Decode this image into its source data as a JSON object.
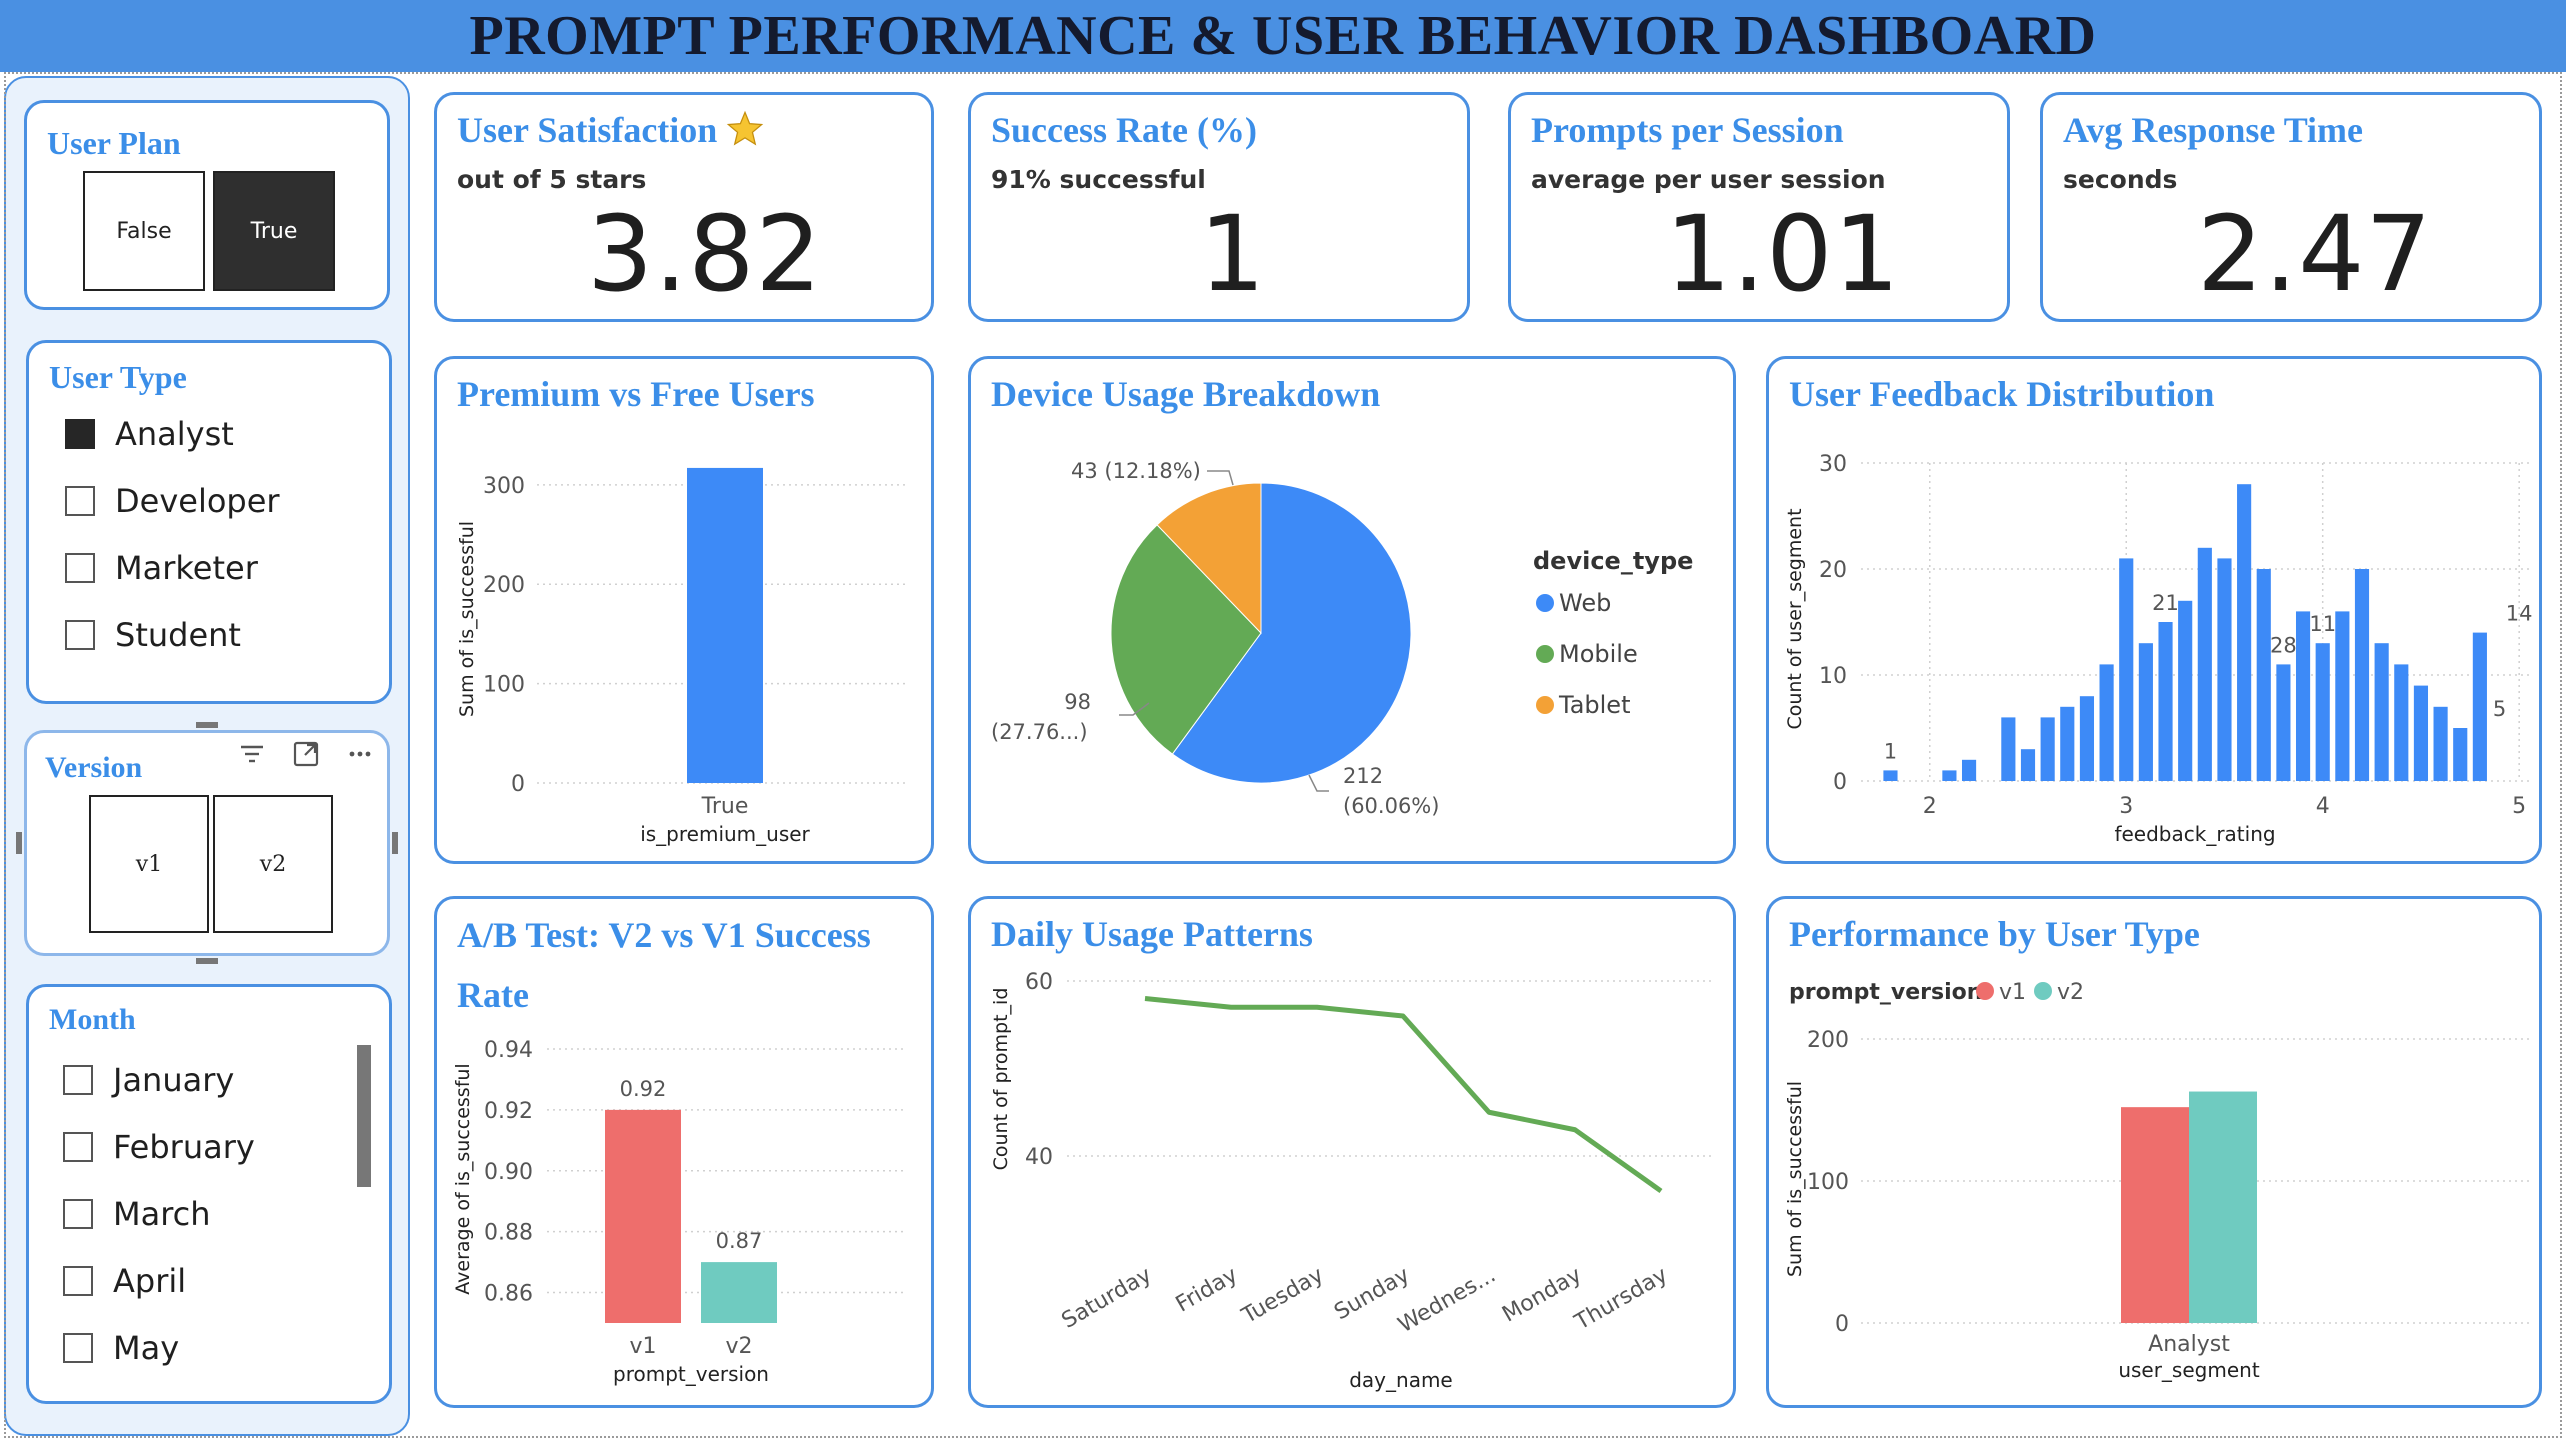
{
  "header": {
    "title": "PROMPT PERFORMANCE & USER BEHAVIOR DASHBOARD"
  },
  "sidebar": {
    "user_plan": {
      "title": "User Plan",
      "options": [
        {
          "label": "False",
          "selected": false
        },
        {
          "label": "True",
          "selected": true
        }
      ]
    },
    "user_type": {
      "title": "User Type",
      "items": [
        {
          "label": "Analyst",
          "checked": true
        },
        {
          "label": "Developer",
          "checked": false
        },
        {
          "label": "Marketer",
          "checked": false
        },
        {
          "label": "Student",
          "checked": false
        }
      ]
    },
    "version": {
      "title": "Version",
      "options": [
        {
          "label": "v1"
        },
        {
          "label": "v2"
        }
      ],
      "toolbar_icons": [
        "filter-icon",
        "expand-icon",
        "more-options-icon"
      ]
    },
    "month": {
      "title": "Month",
      "items": [
        {
          "label": "January",
          "checked": false
        },
        {
          "label": "February",
          "checked": false
        },
        {
          "label": "March",
          "checked": false
        },
        {
          "label": "April",
          "checked": false
        },
        {
          "label": "May",
          "checked": false
        }
      ]
    }
  },
  "kpis": [
    {
      "title": "User Satisfaction",
      "icon": "star-icon",
      "subtitle": "out of 5 stars",
      "value": "3.82"
    },
    {
      "title": "Success Rate (%)",
      "subtitle": "91% successful",
      "value": "1"
    },
    {
      "title": "Prompts per Session",
      "subtitle": "average per user session",
      "value": "1.01"
    },
    {
      "title": "Avg Response Time",
      "subtitle": "seconds",
      "value": "2.47"
    }
  ],
  "colors": {
    "accent": "#4a90e2",
    "title_text": "#3b8ee8",
    "bar_blue": "#3d8af7",
    "green": "#63aa55",
    "orange": "#f3a136",
    "v1": "#ee6e6c",
    "v2": "#6fcbc0",
    "line": "#63aa55"
  },
  "chart_data": [
    {
      "id": "premium",
      "type": "bar",
      "title": "Premium vs Free Users",
      "categories": [
        "True"
      ],
      "values": [
        317
      ],
      "xlabel": "is_premium_user",
      "ylabel": "Sum of is_successful",
      "ylim": [
        0,
        330
      ],
      "yticks": [
        "0",
        "100",
        "200",
        "300"
      ],
      "grid": true
    },
    {
      "id": "device",
      "type": "pie",
      "title": "Device Usage Breakdown",
      "legend_title": "device_type",
      "slices": [
        {
          "label": "Web",
          "value": 212,
          "display": "212",
          "pct": "(60.06%)"
        },
        {
          "label": "Mobile",
          "value": 98,
          "display": "98",
          "pct": "(27.76...)"
        },
        {
          "label": "Tablet",
          "value": 43,
          "display": "43 (12.18%)",
          "pct": ""
        }
      ],
      "legend": "right"
    },
    {
      "id": "feedback",
      "type": "bar",
      "title": "User Feedback Distribution",
      "x": [
        1.8,
        1.9,
        2.0,
        2.1,
        2.2,
        2.3,
        2.4,
        2.5,
        2.6,
        2.7,
        2.8,
        2.9,
        3.0,
        3.1,
        3.2,
        3.3,
        3.4,
        3.5,
        3.6,
        3.7,
        3.8,
        3.9,
        4.0,
        4.1,
        4.2,
        4.3,
        4.4,
        4.5,
        4.6,
        4.7,
        4.8,
        4.9,
        5.0
      ],
      "values": [
        1,
        0,
        0,
        1,
        2,
        0,
        6,
        3,
        6,
        7,
        8,
        11,
        21,
        13,
        15,
        17,
        22,
        21,
        28,
        20,
        11,
        16,
        13,
        16,
        20,
        13,
        11,
        9,
        7,
        5,
        14,
        0,
        0
      ],
      "data_labels": [
        {
          "x": 1.8,
          "label": "1"
        },
        {
          "x": 3.2,
          "label": "21"
        },
        {
          "x": 3.8,
          "label": "28"
        },
        {
          "x": 4.0,
          "label": "11"
        },
        {
          "x": 4.9,
          "label": "5"
        },
        {
          "x": 5.0,
          "label": "14"
        }
      ],
      "xlabel": "feedback_rating",
      "ylabel": "Count of user_segment",
      "xticks": [
        "2",
        "3",
        "4",
        "5"
      ],
      "yticks": [
        "0",
        "10",
        "20",
        "30"
      ],
      "ylim": [
        0,
        30
      ],
      "xlim": [
        1.65,
        5.05
      ],
      "grid": true
    },
    {
      "id": "abtest",
      "type": "bar",
      "title": "A/B Test: V2 vs V1 Success Rate",
      "categories": [
        "v1",
        "v2"
      ],
      "values": [
        0.92,
        0.87
      ],
      "data_labels": [
        "0.92",
        "0.87"
      ],
      "xlabel": "prompt_version",
      "ylabel": "Average of is_successful",
      "yticks": [
        "0.86",
        "0.88",
        "0.90",
        "0.92",
        "0.94"
      ],
      "ylim": [
        0.85,
        0.94
      ],
      "grid": true
    },
    {
      "id": "daily",
      "type": "line",
      "title": "Daily Usage Patterns",
      "categories": [
        "Saturday",
        "Friday",
        "Tuesday",
        "Sunday",
        "Wednes...",
        "Monday",
        "Thursday"
      ],
      "values": [
        58,
        57,
        57,
        56,
        45,
        43,
        36
      ],
      "xlabel": "day_name",
      "ylabel": "Count of prompt_id",
      "yticks": [
        "40",
        "60"
      ],
      "ylim": [
        20,
        60
      ],
      "grid": true
    },
    {
      "id": "usertype",
      "type": "bar",
      "title": "Performance by User Type",
      "legend_title": "prompt_version",
      "categories": [
        "Analyst"
      ],
      "series": [
        {
          "name": "v1",
          "values": [
            152
          ]
        },
        {
          "name": "v2",
          "values": [
            163
          ]
        }
      ],
      "xlabel": "user_segment",
      "ylabel": "Sum of is_successful",
      "yticks": [
        "0",
        "100",
        "200"
      ],
      "ylim": [
        0,
        200
      ],
      "legend": "top-left",
      "grid": true
    }
  ]
}
